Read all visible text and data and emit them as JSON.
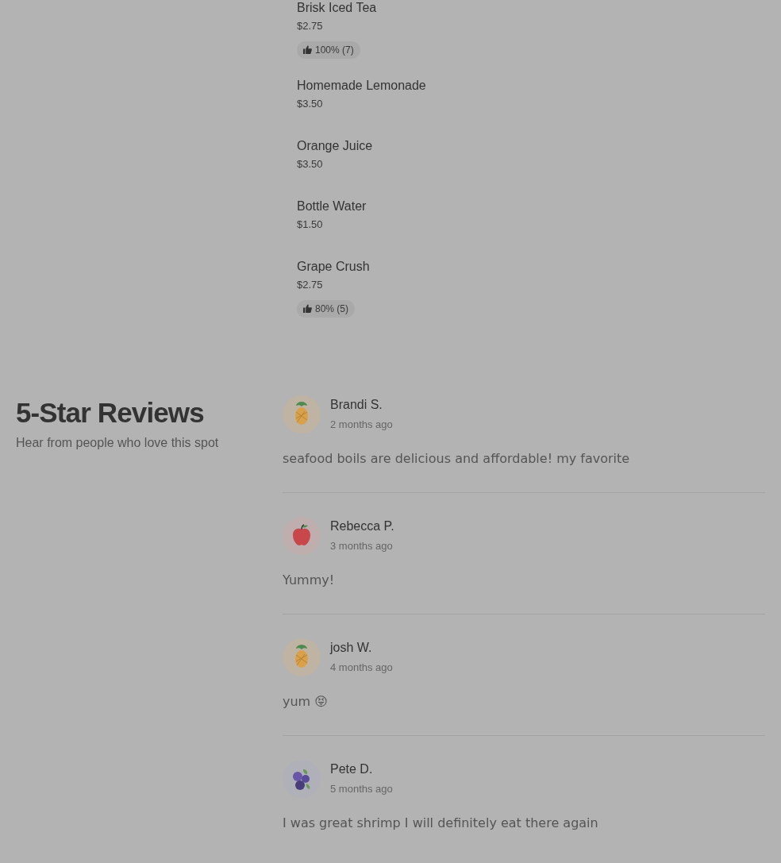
{
  "menu_items": [
    {
      "name": "Brisk Iced Tea",
      "price": "$2.75",
      "rating": "100% (7)"
    },
    {
      "name": "Homemade Lemonade",
      "price": "$3.50"
    },
    {
      "name": "Orange Juice",
      "price": "$3.50"
    },
    {
      "name": "Bottle Water",
      "price": "$1.50"
    },
    {
      "name": "Grape Crush",
      "price": "$2.75",
      "rating": "80% (5)"
    }
  ],
  "reviews_section": {
    "title": "5-Star Reviews",
    "subtitle": "Hear from people who love this spot",
    "reviews": [
      {
        "kind": "pineapple",
        "name": "Brandi S.",
        "time": "2 months ago",
        "text": "seafood boils are delicious and affordable! my favorite"
      },
      {
        "kind": "apple",
        "name": "Rebecca P.",
        "time": "3 months ago",
        "text": "Yummy!"
      },
      {
        "kind": "pineapple",
        "name": "josh W.",
        "time": "4 months ago",
        "text": "yum 😝"
      },
      {
        "kind": "blueberry",
        "name": "Pete D.",
        "time": "5 months ago",
        "text": "I was great shrimp I will definitely eat there again"
      }
    ]
  }
}
